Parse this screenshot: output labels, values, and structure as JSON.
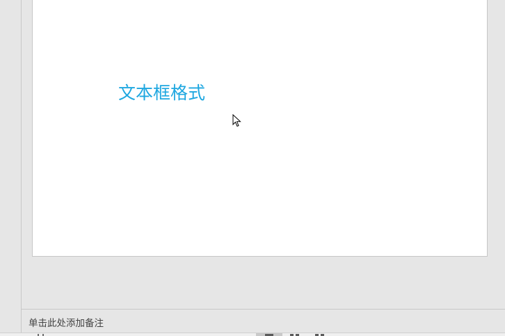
{
  "slide": {
    "textbox_text": "文本框格式"
  },
  "notes": {
    "placeholder": "单击此处添加备注"
  },
  "icons": {
    "cursor": "mouse-pointer-icon",
    "normal_view": "normal-view-icon",
    "slide_sorter": "slide-sorter-icon",
    "reading_view": "reading-view-icon"
  },
  "colors": {
    "textbox_text": "#1ea7e0",
    "background": "#e6e6e6",
    "slide": "#ffffff"
  }
}
